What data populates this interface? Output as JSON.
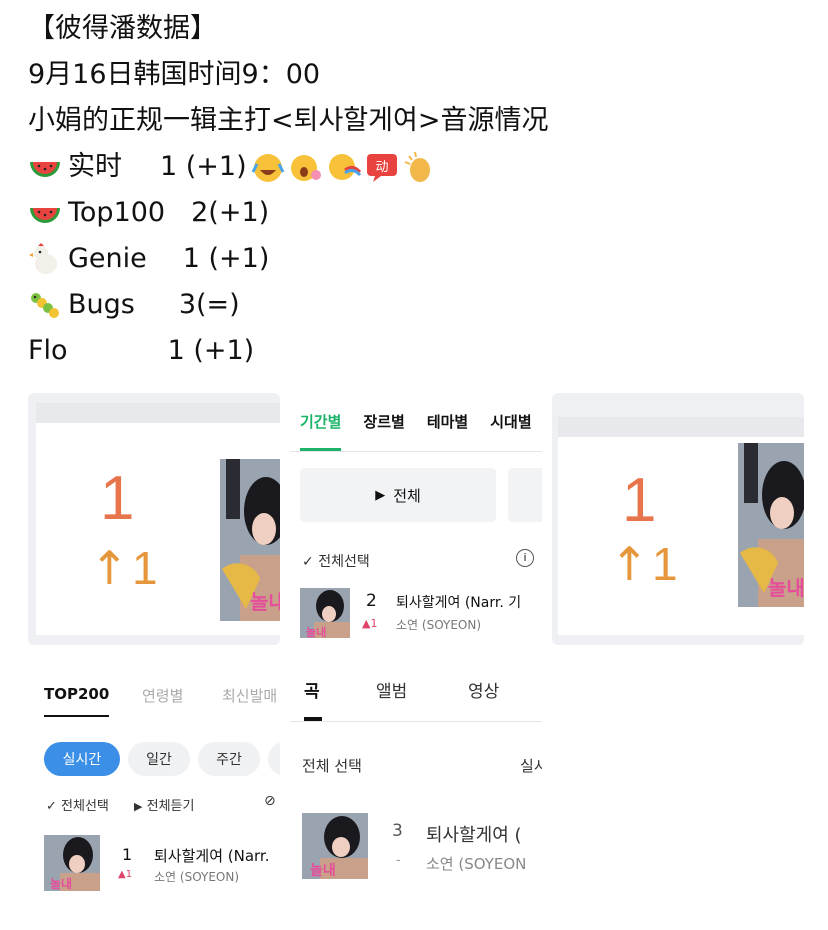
{
  "post": {
    "line1": "【彼得潘数据】",
    "line2": "9月16日韩国时间9：00",
    "line3": "小娟的正规一辑主打<퇴사할게여>音源情况",
    "rows": [
      {
        "icon": "watermelon-icon",
        "label": "实时",
        "value": "1 (+1)"
      },
      {
        "icon": "watermelon-icon",
        "label": "Top100",
        "value": "2(+1)"
      },
      {
        "icon": "chicken-icon",
        "label": "Genie",
        "value": "1 (+1)"
      },
      {
        "icon": "bug-icon",
        "label": "Bugs",
        "value": "3(=)"
      },
      {
        "icon": "",
        "label": "Flo",
        "value": "1 (+1)"
      }
    ]
  },
  "panel1": {
    "rank": "1",
    "change": "1"
  },
  "panel2": {
    "tabs": [
      "기간별",
      "장르별",
      "테마별",
      "시대별"
    ],
    "play_all": "전체",
    "select_all": "전체선택",
    "rank": "2",
    "title": "퇴사할게여 (Narr. 기",
    "change": "1",
    "artist": "소연 (SOYEON)"
  },
  "panel3": {
    "rank": "1",
    "change": "1"
  },
  "panel4": {
    "tabs": [
      "TOP200",
      "연령별",
      "최신발매"
    ],
    "pills": [
      "실시간",
      "일간",
      "주간"
    ],
    "select_all": "전체선택",
    "play_all": "전체듣기",
    "rank": "1",
    "title": "퇴사할게여 (Narr.",
    "change": "1",
    "artist": "소연 (SOYEON)"
  },
  "panel5": {
    "tabs": [
      "곡",
      "앨범",
      "영상"
    ],
    "select_all": "전체 선택",
    "right_label": "실시",
    "rank": "3",
    "title": "퇴사할게여 (",
    "change": "-",
    "artist": "소연 (SOYEON"
  },
  "colors": {
    "melon_green": "#1db46a",
    "rank_orange": "#e8744b",
    "arrow_orange": "#e6963b",
    "up_red": "#e0436a",
    "genie_blue": "#3b8fe6"
  }
}
